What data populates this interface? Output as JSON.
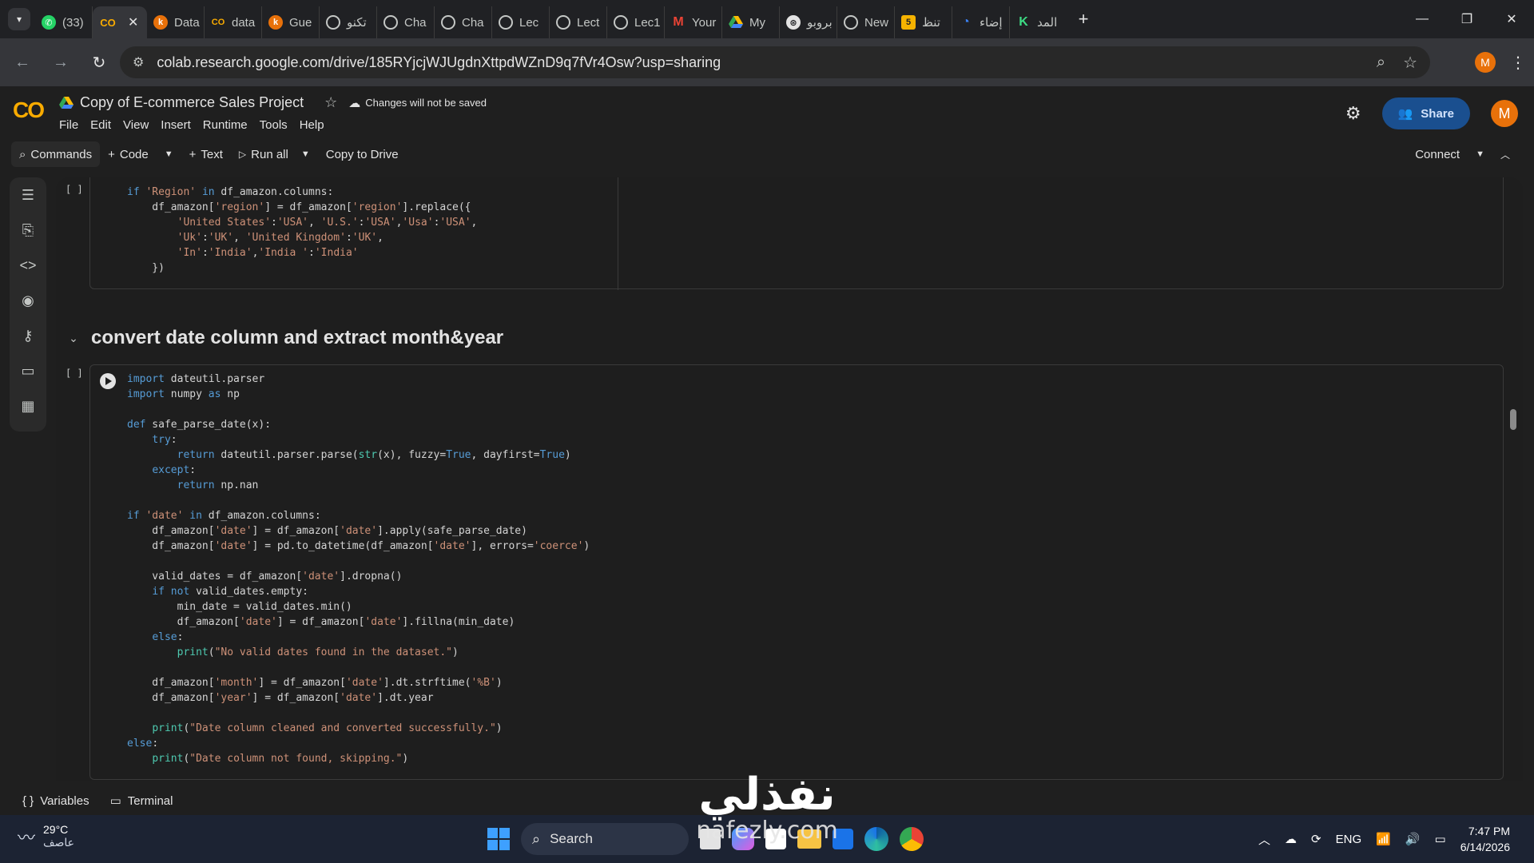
{
  "browser": {
    "tabs": [
      {
        "label": "(33)",
        "icon": "whatsapp-icon",
        "color": "#25d366"
      },
      {
        "label": "",
        "icon": "colab-icon",
        "color": "#f9ab00",
        "active": true
      },
      {
        "label": "Data",
        "icon": "kaggle-icon",
        "color": "#e8710a"
      },
      {
        "label": "data",
        "icon": "colab-icon",
        "color": "#f9ab00"
      },
      {
        "label": "Gue",
        "icon": "kaggle-icon",
        "color": "#e8710a"
      },
      {
        "label": "تكنو",
        "icon": "chatgpt-icon",
        "color": "#c4c7c5"
      },
      {
        "label": "Cha",
        "icon": "chatgpt-icon",
        "color": "#c4c7c5"
      },
      {
        "label": "Cha",
        "icon": "chatgpt-icon",
        "color": "#c4c7c5"
      },
      {
        "label": "Lec",
        "icon": "chatgpt-icon",
        "color": "#c4c7c5"
      },
      {
        "label": "Lect",
        "icon": "chatgpt-icon",
        "color": "#c4c7c5"
      },
      {
        "label": "Lec1",
        "icon": "chatgpt-icon",
        "color": "#c4c7c5"
      },
      {
        "label": "Your",
        "icon": "gmail-icon",
        "color": "#ea4335"
      },
      {
        "label": "My",
        "icon": "drive-icon",
        "color": "#34a853"
      },
      {
        "label": "بروبو",
        "icon": "openai-icon",
        "color": "#e3e3e3"
      },
      {
        "label": "New",
        "icon": "chatgpt-icon",
        "color": "#c4c7c5"
      },
      {
        "label": "تنظ",
        "icon": "five-icon",
        "color": "#f6b300"
      },
      {
        "label": "إضاء",
        "icon": "app-icon",
        "color": "#3b82f6"
      },
      {
        "label": "المد",
        "icon": "k-icon",
        "color": "#3ddc84"
      }
    ],
    "url": "colab.research.google.com/drive/185RYjcjWJUgdnXttpdWZnD9q7fVr4Osw?usp=sharing",
    "profile_initial": "M"
  },
  "colab": {
    "logo": "CO",
    "title": "Copy of E-commerce Sales Project",
    "unsaved_label": "Changes will not be saved",
    "menu": [
      "File",
      "Edit",
      "View",
      "Insert",
      "Runtime",
      "Tools",
      "Help"
    ],
    "share_label": "Share",
    "avatar_initial": "M",
    "toolbar": {
      "commands": "Commands",
      "code": "Code",
      "text": "Text",
      "run_all": "Run all",
      "copy_to_drive": "Copy to Drive",
      "connect": "Connect"
    }
  },
  "notebook": {
    "cell1_count": "[ ]",
    "section_heading": "convert date column and extract month&year",
    "cell2_count": "[ ]"
  },
  "statusbar": {
    "variables": "Variables",
    "terminal": "Terminal"
  },
  "taskbar": {
    "temperature": "29°C",
    "weather_desc": "عاصف",
    "search": "Search",
    "lang": "ENG",
    "time": "7:47 PM",
    "date": "6/14/2026"
  },
  "watermark": {
    "arabic": "نفذلي",
    "site": "nafezly.com"
  },
  "colors": {
    "accent": "#f9ab00",
    "share_bg": "#1a4f8f",
    "keyword": "#569cd6",
    "string": "#ce9178"
  }
}
